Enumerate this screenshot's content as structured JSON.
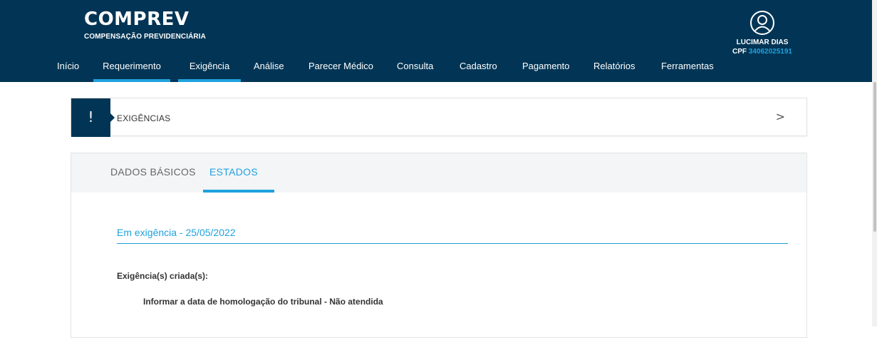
{
  "header": {
    "brand_name": "COMPREV",
    "brand_sub": "COMPENSAÇÃO PREVIDENCIÁRIA",
    "nav": [
      {
        "label": "Início",
        "active": false
      },
      {
        "label": "Requerimento",
        "active": true
      },
      {
        "label": "Exigência",
        "active": true
      },
      {
        "label": "Análise",
        "active": false
      },
      {
        "label": "Parecer Médico",
        "active": false
      },
      {
        "label": "Consulta",
        "active": false
      },
      {
        "label": "Cadastro",
        "active": false
      },
      {
        "label": "Pagamento",
        "active": false
      },
      {
        "label": "Relatórios",
        "active": false
      },
      {
        "label": "Ferramentas",
        "active": false
      }
    ],
    "user": {
      "icon": "user-icon",
      "name": "LUCIMAR DIAS",
      "cpf_label": "CPF",
      "cpf_number": "34062025191"
    }
  },
  "section": {
    "icon": "exclamation-icon",
    "icon_glyph": "!",
    "title": "EXIGÊNCIAS",
    "chevron": ">"
  },
  "tabs": [
    {
      "label": "DADOS BÁSICOS",
      "active": false
    },
    {
      "label": "ESTADOS",
      "active": true
    }
  ],
  "content": {
    "status": "Em exigência - 25/05/2022",
    "created_label": "Exigência(s) criada(s):",
    "item": "Informar a data de homologação do tribunal - Não atendida"
  },
  "colors": {
    "header_bg": "#023555",
    "accent": "#1fa1dd"
  }
}
